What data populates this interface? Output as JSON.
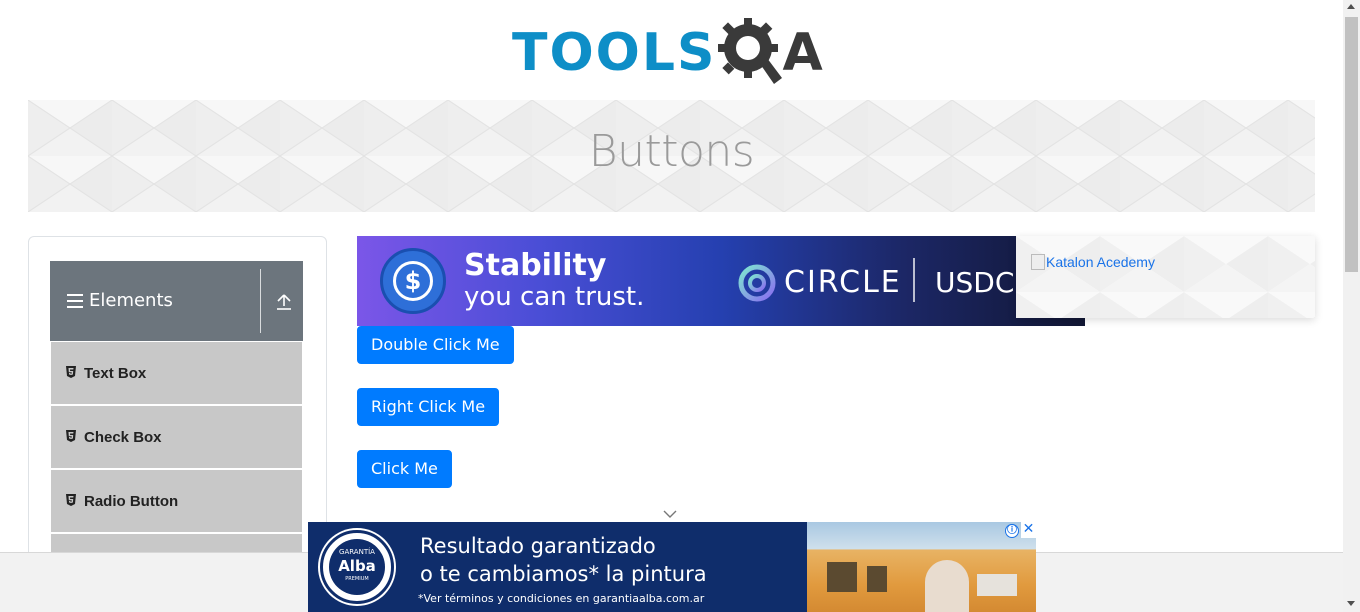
{
  "header": {
    "logo_text_left": "TOOLS",
    "logo_text_right": "A",
    "colors": {
      "logo_blue": "#0e8ec7",
      "logo_dark": "#3a3a3a"
    }
  },
  "banner": {
    "title": "Buttons"
  },
  "sidebar": {
    "group": {
      "label": "Elements",
      "menu_icon": "hamburger-icon",
      "collapse_icon": "upload-icon"
    },
    "items": [
      {
        "label": "Text Box",
        "icon": "html5-icon"
      },
      {
        "label": "Check Box",
        "icon": "html5-icon"
      },
      {
        "label": "Radio Button",
        "icon": "html5-icon"
      }
    ],
    "colors": {
      "group_bg": "#6c757d",
      "item_bg": "#c8c8c8"
    }
  },
  "ads": {
    "top": {
      "line1": "Stability",
      "line2": "you can trust.",
      "brand": "CIRCLE",
      "product": "USDC"
    },
    "right": {
      "alt_text": "Katalon Acedemy"
    },
    "bottom": {
      "seal_top": "GARANTÍA",
      "seal_brand": "Alba",
      "seal_sub": "PREMIUM",
      "line1": "Resultado garantizado",
      "line2": "o te cambiamos* la pintura",
      "line3": "*Ver términos y condiciones en garantiaalba.com.ar",
      "info_icon": "ⓘ",
      "close_icon": "✕"
    }
  },
  "buttons": {
    "double_click": "Double Click Me",
    "right_click": "Right Click Me",
    "click": "Click Me",
    "color": "#007bff"
  }
}
